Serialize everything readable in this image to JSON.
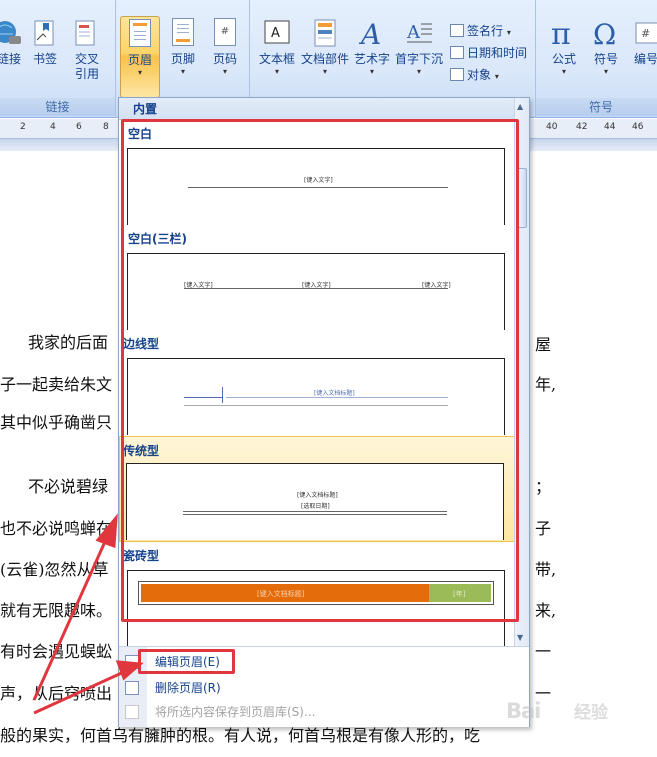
{
  "ribbon": {
    "groups": [
      {
        "label": "链接",
        "buttons": [
          "链接",
          "书签",
          "交叉\n引用"
        ]
      },
      {
        "label": "",
        "buttons": [
          "页眉",
          "页脚",
          "页码"
        ]
      },
      {
        "label": "",
        "buttons": [
          "文本框",
          "文档部件",
          "艺术字",
          "首字下沉"
        ]
      },
      {
        "label": "符号",
        "buttons": [
          "公式",
          "符号",
          "编号"
        ]
      }
    ],
    "small_items": [
      "签名行",
      "日期和时间",
      "对象"
    ]
  },
  "ruler": {
    "ticks": [
      "2",
      "4",
      "6",
      "8",
      "40",
      "42",
      "44",
      "46"
    ]
  },
  "document": {
    "lines": [
      "我家的后面",
      "子一起卖给朱文",
      "其中似乎确凿只",
      "不必说碧绿",
      "也不必说鸣蝉在",
      "(云雀)忽然从草",
      "就有无限趣味。",
      "有时会遇见蜈蚣",
      "声，从后窍喷出",
      "般的果实，何首乌有臃肿的根。有人说，何首乌根是有像人形的，吃"
    ],
    "right_fragments": [
      "屋",
      "年,",
      "；",
      "子",
      "带,",
      "来,",
      "一",
      "一"
    ]
  },
  "dropdown": {
    "header": "内置",
    "items": [
      {
        "title": "空白",
        "placeholders": [
          "[键入文字]"
        ]
      },
      {
        "title": "空白(三栏)",
        "placeholders": [
          "[键入文字]",
          "[键入文字]",
          "[键入文字]"
        ]
      },
      {
        "title": "边线型",
        "placeholders": [
          "[键入文档标题]"
        ]
      },
      {
        "title": "传统型",
        "placeholders": [
          "[键入文档标题]",
          "[选取日期]"
        ]
      },
      {
        "title": "瓷砖型",
        "placeholders": [
          "[键入文档标题]",
          "[年]"
        ]
      }
    ],
    "menu": [
      {
        "label": "编辑页眉(E)"
      },
      {
        "label": "删除页眉(R)"
      },
      {
        "label": "将所选内容保存到页眉库(S)..."
      }
    ]
  },
  "colors": {
    "annotation": "#e0373e",
    "tile_orange": "#e46c0a",
    "tile_green": "#9bbb59",
    "highlight": "#fde7a1"
  },
  "watermark": {
    "text": "Bai",
    "sub": "经验"
  }
}
